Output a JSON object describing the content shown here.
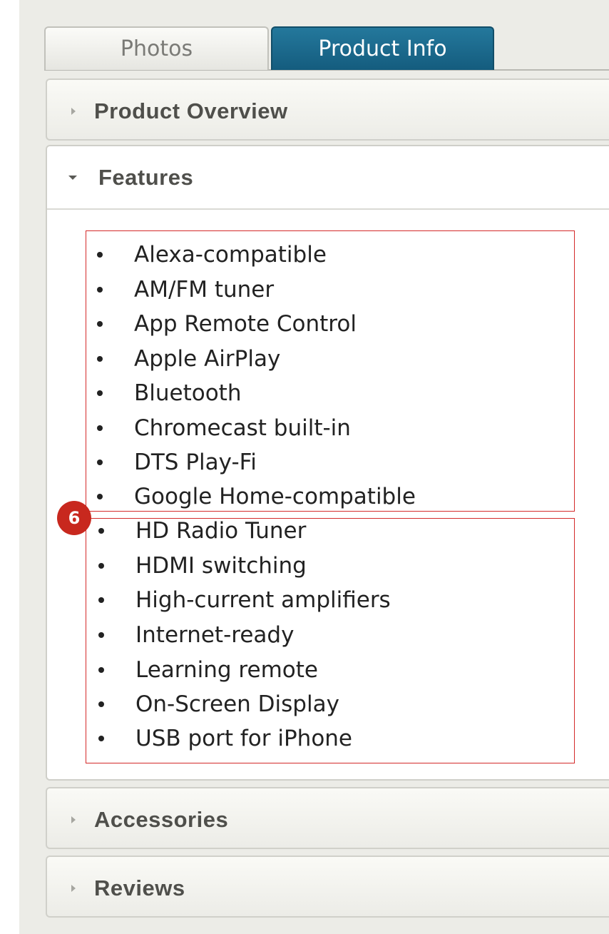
{
  "tabs": [
    {
      "label": "Photos",
      "active": false
    },
    {
      "label": "Product Info",
      "active": true
    }
  ],
  "sections": {
    "overview": {
      "title": "Product Overview",
      "expanded": false
    },
    "features": {
      "title": "Features",
      "expanded": true,
      "items": [
        "Alexa-compatible",
        "AM/FM tuner",
        "App Remote Control",
        "Apple AirPlay",
        "Bluetooth",
        "Chromecast built-in",
        "DTS Play-Fi",
        "Google Home-compatible",
        "HD Radio Tuner",
        "HDMI switching",
        "High-current amplifiers",
        "Internet-ready",
        "Learning remote",
        "On-Screen Display",
        "USB port for iPhone"
      ]
    },
    "accessories": {
      "title": "Accessories",
      "expanded": false
    },
    "reviews": {
      "title": "Reviews",
      "expanded": false
    }
  },
  "annotation": {
    "badge": "6"
  },
  "colors": {
    "active_tab": "#1b6a8e",
    "annotation_red": "#c8281e",
    "panel_bg": "#ecece7"
  }
}
